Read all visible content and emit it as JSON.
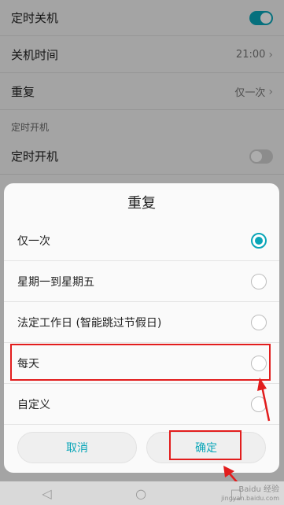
{
  "settings": {
    "rows": [
      {
        "label": "定时关机",
        "toggle": "on"
      },
      {
        "label": "关机时间",
        "value": "21:00"
      },
      {
        "label": "重复",
        "value": "仅一次"
      }
    ],
    "section_title": "定时开机",
    "power_on_row": {
      "label": "定时开机",
      "toggle": "off"
    }
  },
  "dialog": {
    "title": "重复",
    "options": [
      {
        "label": "仅一次",
        "checked": true
      },
      {
        "label": "星期一到星期五",
        "checked": false
      },
      {
        "label": "法定工作日 (智能跳过节假日)",
        "checked": false
      },
      {
        "label": "每天",
        "checked": false
      },
      {
        "label": "自定义",
        "checked": false
      }
    ],
    "cancel_label": "取消",
    "confirm_label": "确定"
  },
  "watermark": {
    "main": "Baidu 经验",
    "sub": "jingyan.baidu.com"
  },
  "colors": {
    "accent": "#0aa6b8",
    "annotation": "#e21d1d"
  }
}
